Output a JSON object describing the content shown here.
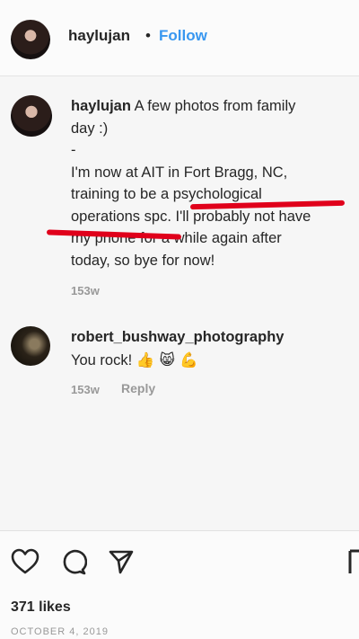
{
  "header": {
    "username": "haylujan",
    "separator": "•",
    "follow_label": "Follow",
    "more_icon": "⋮"
  },
  "caption": {
    "username": "haylujan",
    "lines": [
      "A few photos from family",
      "day :)",
      "-",
      "I'm now at AIT in Fort Bragg, NC,",
      "training to be a psychological",
      "operations spc. I'll probably not have",
      "my phone for a while again after",
      "today, so bye for now!"
    ],
    "timestamp": "153w"
  },
  "comment": {
    "username": "robert_bushway_photography",
    "text": "You rock!",
    "emojis": "👍 😸 💪",
    "timestamp": "153w",
    "reply_label": "Reply"
  },
  "actions": {
    "like_icon": "heart-icon",
    "comment_icon": "comment-icon",
    "share_icon": "share-icon",
    "save_icon": "bookmark-icon"
  },
  "likes": "371 likes",
  "date": "OCTOBER 4, 2019",
  "colors": {
    "follow": "#3897f0",
    "redact_line": "#e0001b",
    "muted": "#999999"
  }
}
